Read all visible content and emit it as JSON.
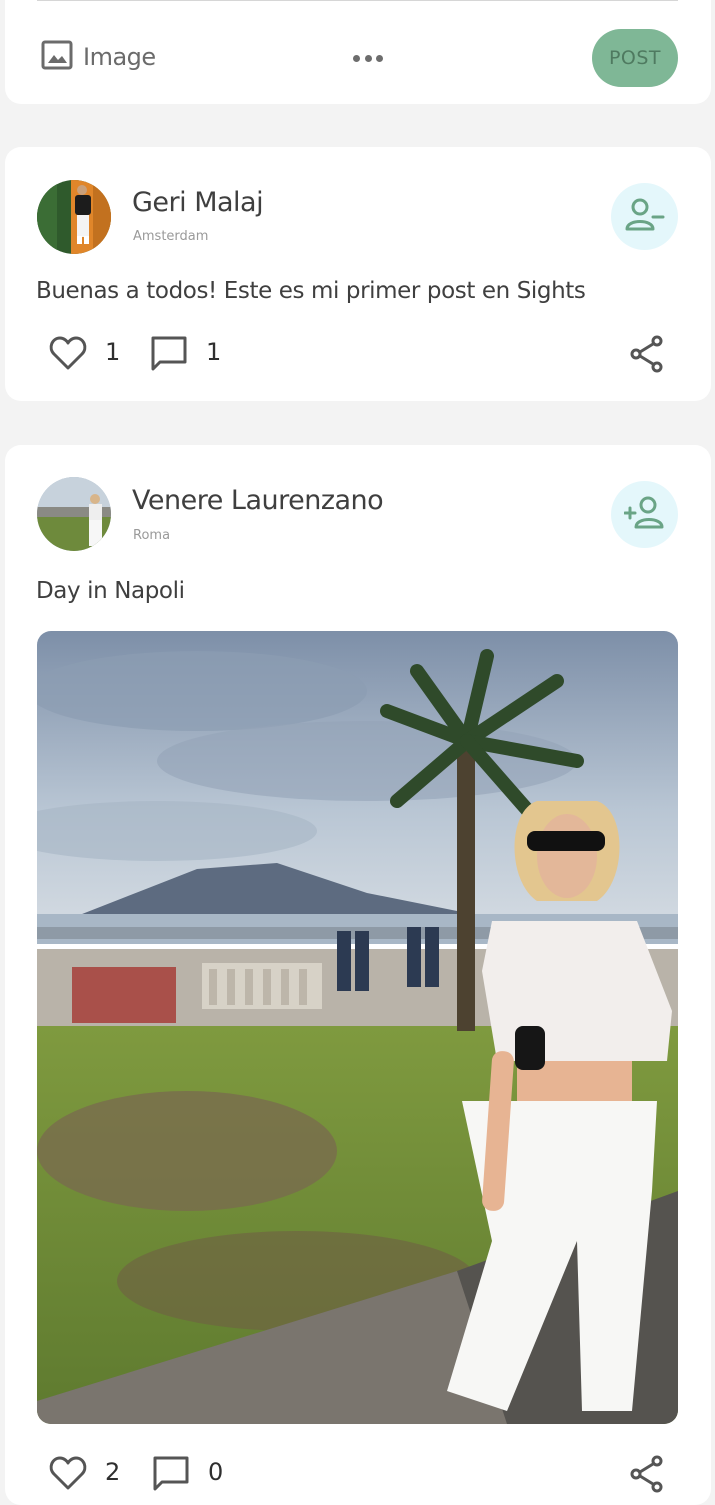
{
  "composer": {
    "image_label": "Image",
    "post_label": "POST",
    "image_icon": "image-icon",
    "more_icon": "more-horizontal-icon"
  },
  "posts": [
    {
      "author": "Geri Malaj",
      "location": "Amsterdam",
      "text": "Buenas a todos! Este es mi primer post en Sights",
      "likes": "1",
      "comments": "1",
      "follow_icon": "person-remove-icon",
      "has_image": false
    },
    {
      "author": "Venere Laurenzano",
      "location": "Roma",
      "text": "Day in Napoli",
      "likes": "2",
      "comments": "0",
      "follow_icon": "person-add-icon",
      "has_image": true
    }
  ],
  "colors": {
    "accent": "#7fb796",
    "follow_bg": "#e4f7fb",
    "page_bg": "#f3f3f3",
    "icon": "#555555"
  }
}
